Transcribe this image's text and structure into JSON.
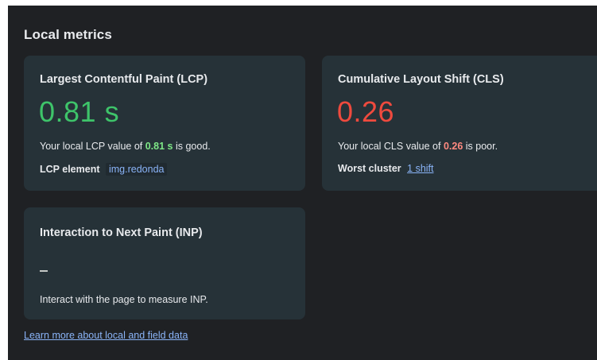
{
  "section": {
    "title": "Local metrics"
  },
  "lcp": {
    "title": "Largest Contentful Paint (LCP)",
    "value": "0.81 s",
    "desc_prefix": "Your local LCP value of ",
    "desc_value": "0.81 s",
    "desc_suffix": " is good.",
    "element_label": "LCP element",
    "element_value": "img.redonda",
    "rating_color": "#3ec46a"
  },
  "cls": {
    "title": "Cumulative Layout Shift (CLS)",
    "value": "0.26",
    "desc_prefix": "Your local CLS value of ",
    "desc_value": "0.26",
    "desc_suffix": " is poor.",
    "cluster_label": "Worst cluster",
    "cluster_link": "1 shift",
    "rating_color": "#ef4a3e"
  },
  "inp": {
    "title": "Interaction to Next Paint (INP)",
    "value": "–",
    "desc": "Interact with the page to measure INP."
  },
  "footer": {
    "learn_more": "Learn more about local and field data"
  },
  "colors": {
    "background": "#1f2124",
    "card": "#263238",
    "link": "#8ab4f8",
    "good": "#3ec46a",
    "poor": "#ef4a3e"
  }
}
